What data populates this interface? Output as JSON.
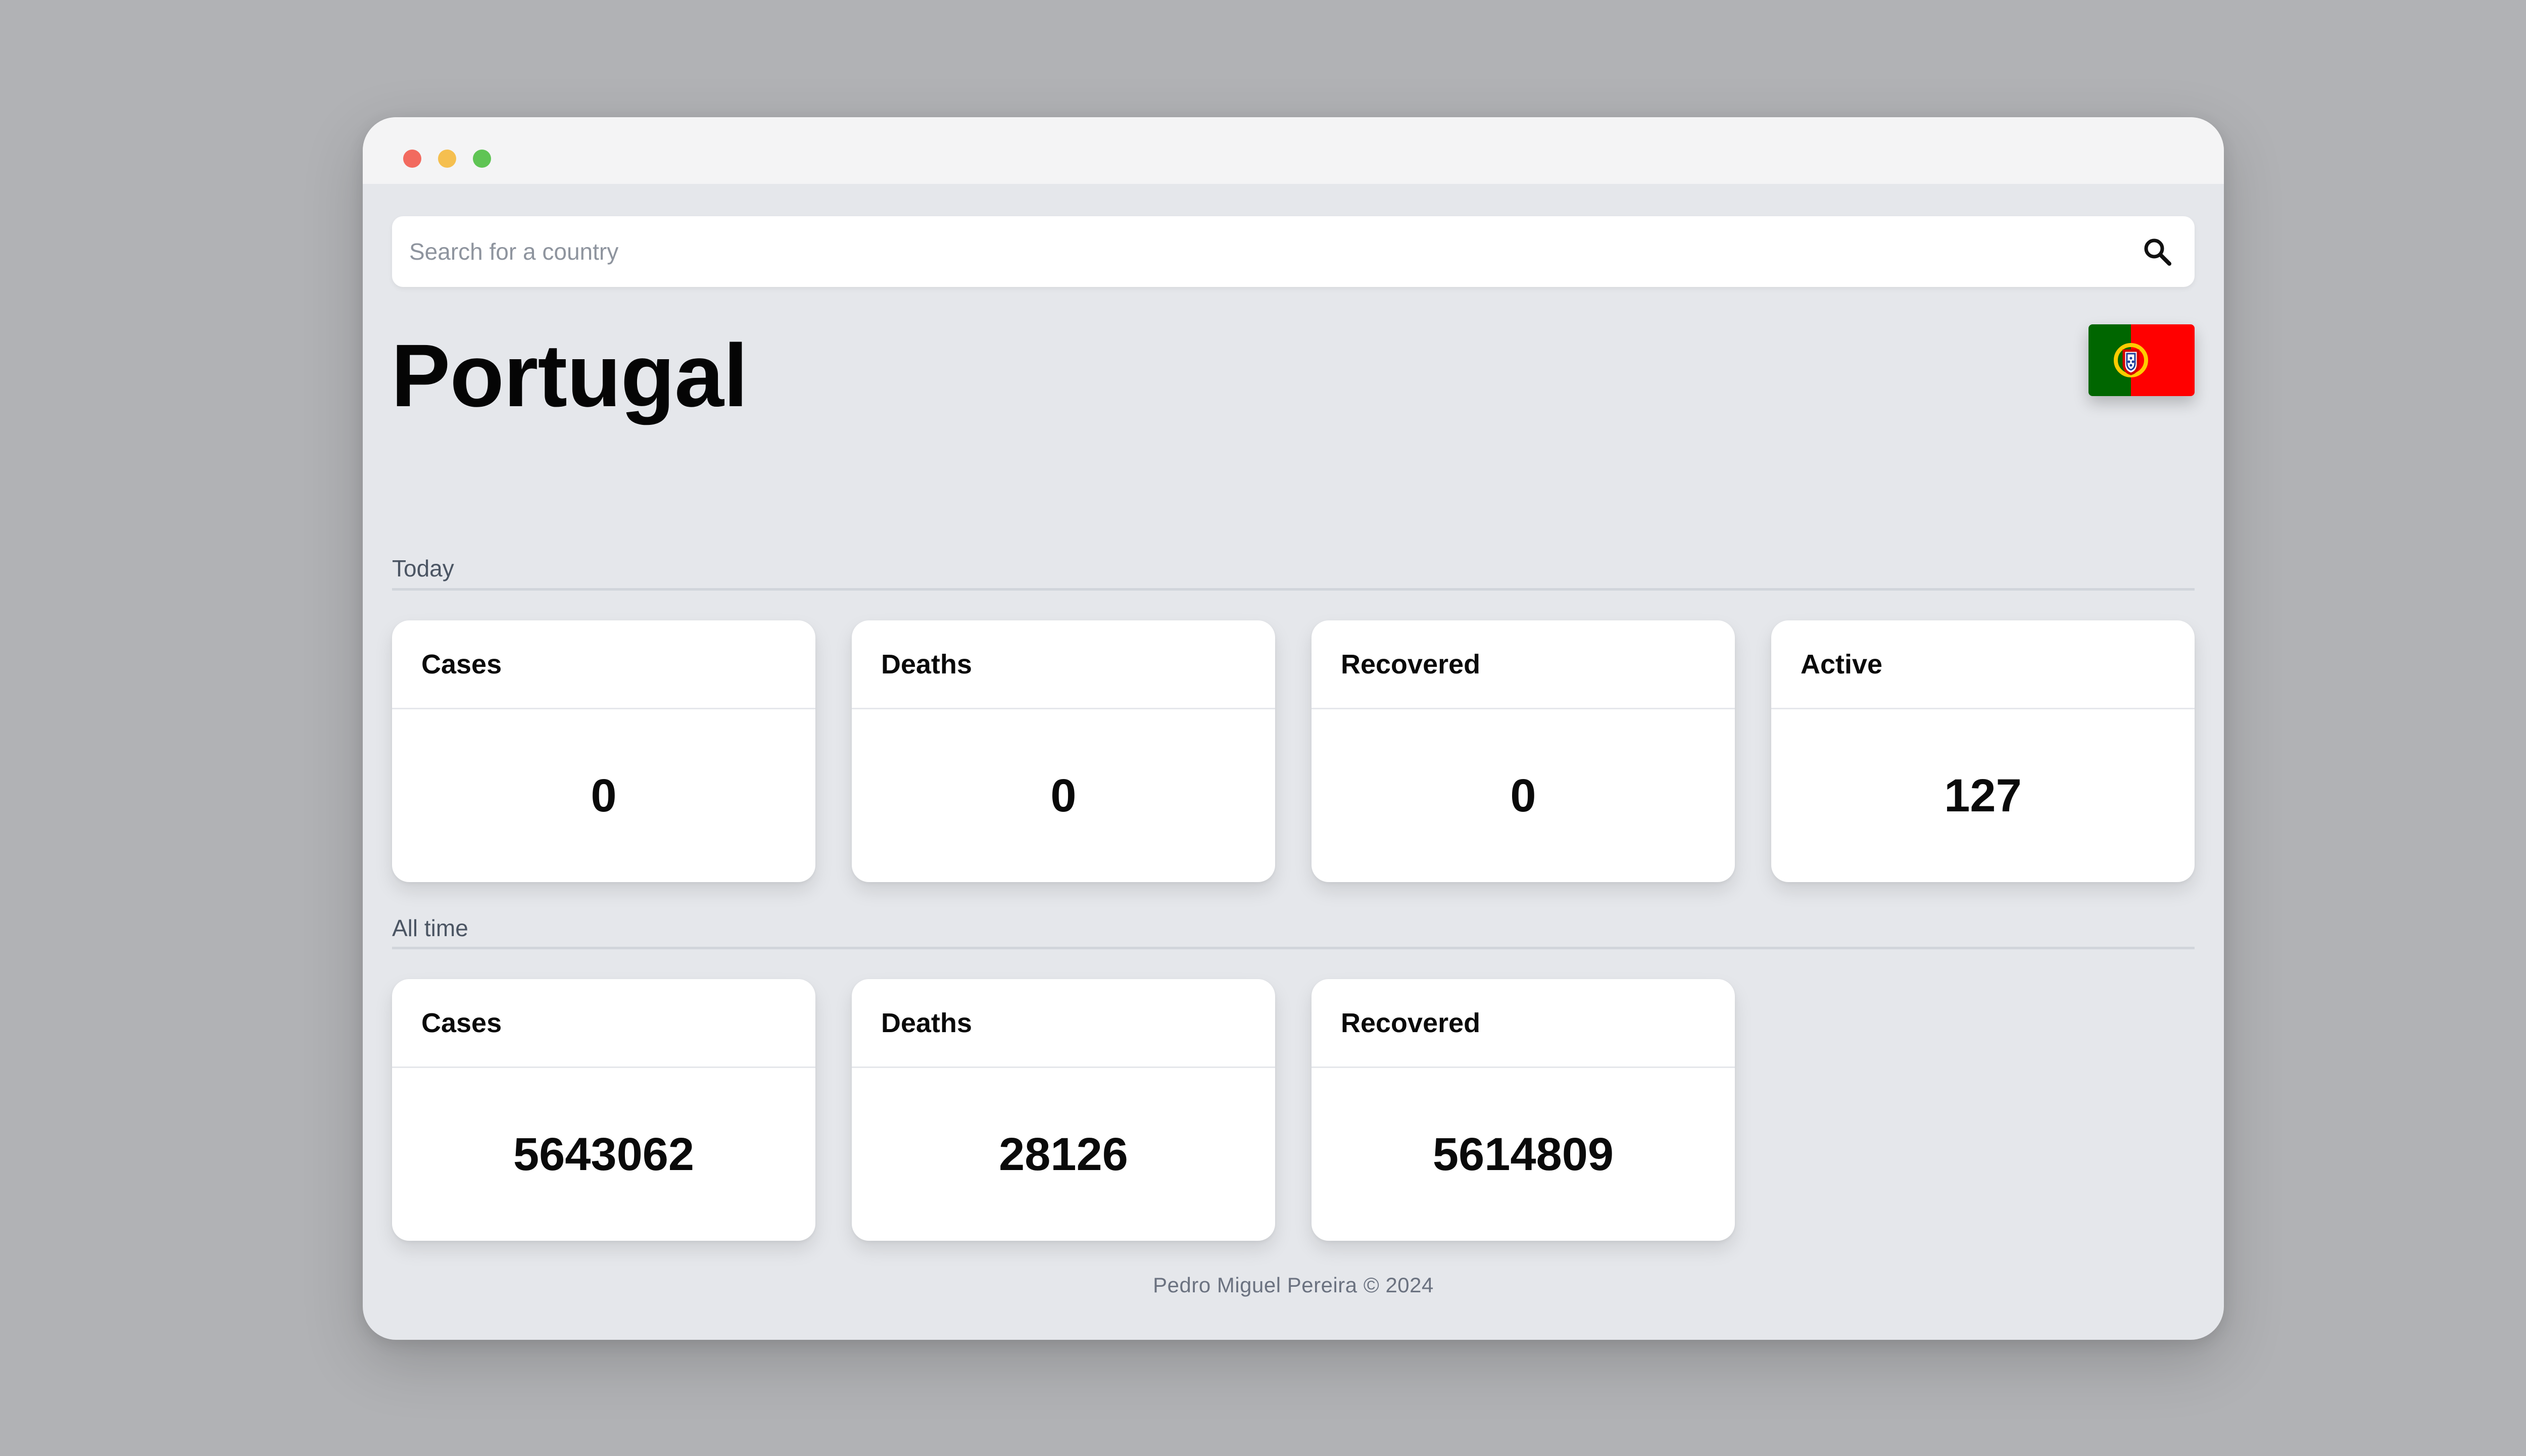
{
  "window": {
    "controls": [
      "close",
      "minimize",
      "zoom"
    ]
  },
  "search": {
    "placeholder": "Search for a country",
    "value": "",
    "icon": "search-icon"
  },
  "country": {
    "name": "Portugal",
    "flag": {
      "icon": "flag-portugal-icon",
      "colors": {
        "green": "#006600",
        "red": "#ff0000",
        "gold": "#ffcc00"
      }
    }
  },
  "sections": {
    "today": {
      "label": "Today",
      "cards": [
        {
          "title": "Cases",
          "value": "0"
        },
        {
          "title": "Deaths",
          "value": "0"
        },
        {
          "title": "Recovered",
          "value": "0"
        },
        {
          "title": "Active",
          "value": "127"
        }
      ]
    },
    "all_time": {
      "label": "All time",
      "cards": [
        {
          "title": "Cases",
          "value": "5643062"
        },
        {
          "title": "Deaths",
          "value": "28126"
        },
        {
          "title": "Recovered",
          "value": "5614809"
        }
      ]
    }
  },
  "footer": {
    "text": "Pedro Miguel Pereira © 2024"
  },
  "colors": {
    "background": "#b1b2b5",
    "window": "#e5e7eb",
    "titlebar": "#f4f4f5",
    "card": "#ffffff",
    "text": "#0a0a0a",
    "muted": "#6b7280"
  }
}
